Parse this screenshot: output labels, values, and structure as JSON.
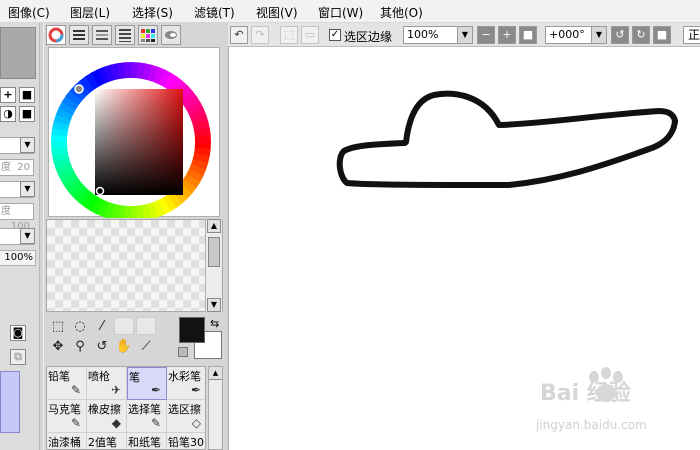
{
  "menu": [
    "图像(C)",
    "图层(L)",
    "选择(S)",
    "滤镜(T)",
    "视图(V)",
    "窗口(W)",
    "其他(O)"
  ],
  "left_strip": {
    "field_1_label": "度",
    "field_1_value": "20",
    "field_2_label": "度",
    "field_2_value": "100",
    "opacity_value": "100%"
  },
  "color_panel": {
    "mode_tabs": [
      "color-wheel",
      "rgb-sliders",
      "hsv-sliders",
      "color-bar",
      "swatches",
      "scratchpad"
    ],
    "foreground_color": "#121212",
    "background_color": "#ffffff"
  },
  "tools": [
    "rect-select",
    "lasso",
    "magic-wand",
    "",
    "",
    "move",
    "zoom",
    "rotate",
    "hand",
    "eyedropper"
  ],
  "brushes": [
    {
      "label": "铅笔",
      "icon": "pencil-icon"
    },
    {
      "label": "喷枪",
      "icon": "airbrush-icon"
    },
    {
      "label": "笔",
      "icon": "pen-icon",
      "selected": true
    },
    {
      "label": "水彩笔",
      "icon": "watercolor-icon"
    },
    {
      "label": "马克笔",
      "icon": "marker-icon"
    },
    {
      "label": "橡皮擦",
      "icon": "eraser-icon"
    },
    {
      "label": "选择笔",
      "icon": "select-pen-icon"
    },
    {
      "label": "选区擦",
      "icon": "select-eraser-icon"
    },
    {
      "label": "油漆桶",
      "icon": "bucket-icon"
    },
    {
      "label": "2值笔",
      "icon": "binary-pen-icon"
    },
    {
      "label": "和纸笔",
      "icon": "washi-pen-icon"
    },
    {
      "label": "铅笔30",
      "icon": "pencil-icon"
    }
  ],
  "canvas_toolbar": {
    "selection_edge_label": "选区边缘",
    "selection_edge_checked": true,
    "zoom_value": "100%",
    "rotation_value": "+000°",
    "blend_label": "正"
  },
  "watermark": {
    "text": "Bai 经验",
    "sub": "jingyan.baidu.com"
  }
}
